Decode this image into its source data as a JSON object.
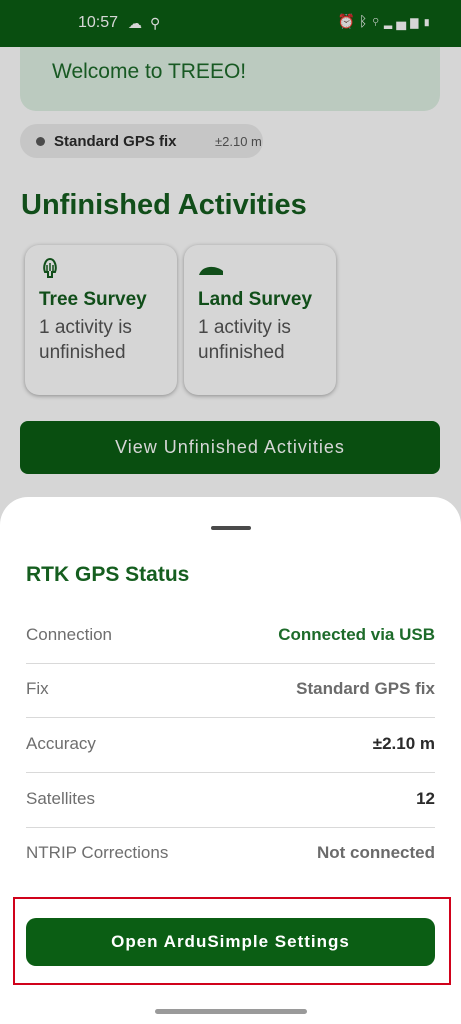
{
  "status_bar": {
    "time": "10:57",
    "left_icons": [
      "cloud-icon",
      "location-icon"
    ],
    "right_icons": [
      "alarm-icon",
      "bluetooth-icon",
      "location-icon",
      "signal-icon",
      "battery-icon"
    ]
  },
  "welcome": {
    "text": "Welcome to TREEO!"
  },
  "gps_chip": {
    "label": "Standard GPS fix",
    "accuracy": "±2.10 m"
  },
  "section": {
    "title": "Unfinished Activities"
  },
  "cards": [
    {
      "title": "Tree Survey",
      "subtitle": "1 activity is unfinished",
      "icon": "tree-icon"
    },
    {
      "title": "Land Survey",
      "subtitle": "1 activity is unfinished",
      "icon": "land-icon"
    }
  ],
  "view_button": {
    "label": "View Unfinished Activities"
  },
  "sheet": {
    "title": "RTK GPS Status",
    "rows": [
      {
        "key": "Connection",
        "value": "Connected via USB"
      },
      {
        "key": "Fix",
        "value": "Standard GPS fix"
      },
      {
        "key": "Accuracy",
        "value": "±2.10 m"
      },
      {
        "key": "Satellites",
        "value": "12"
      },
      {
        "key": "NTRIP Corrections",
        "value": "Not connected"
      }
    ],
    "button_label": "Open ArduSimple Settings"
  },
  "colors": {
    "brand_green": "#0b5e14",
    "title_green": "#155e1f",
    "highlight_red": "#d0021b"
  }
}
